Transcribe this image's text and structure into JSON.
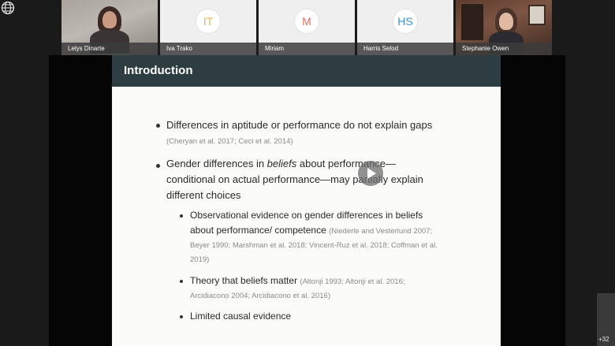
{
  "participants": [
    {
      "name": "Lelys Dinarte",
      "type": "video"
    },
    {
      "name": "Iva Trako",
      "type": "initials",
      "initials": "IT",
      "color": "#e8b64a"
    },
    {
      "name": "Miriam",
      "type": "initials",
      "initials": "M",
      "color": "#e0705e"
    },
    {
      "name": "Harris Selod",
      "type": "initials",
      "initials": "HS",
      "color": "#3d8fd1"
    },
    {
      "name": "Stephanie Owen",
      "type": "video"
    }
  ],
  "slide": {
    "title": "Introduction",
    "bullet1": {
      "text": "Differences in aptitude or performance do not explain gaps",
      "cite": "(Cheryan et al. 2017; Ceci et al. 2014)"
    },
    "bullet2": {
      "line1_pre": "Gender differences in ",
      "line1_em": "beliefs",
      "line1_post": " about performance—",
      "line2": "conditional on actual performance—may partially explain",
      "line3": "different choices"
    },
    "sub1": {
      "line1": "Observational evidence on gender differences in beliefs",
      "line2": "about performance/ competence",
      "cite1": "(Niederle and Vesterlund 2007;",
      "cite2": "Beyer 1990; Marshman et al. 2018; Vincent-Ruz et al. 2018; Coffman et al.",
      "cite3": "2019)"
    },
    "sub2": {
      "text": "Theory that beliefs matter",
      "cite1": "(Altonji 1993; Altonji et al. 2016;",
      "cite2": "Arcidiacono 2004; Arcidiacono et al. 2016)"
    },
    "sub3": {
      "text": "Limited causal evidence"
    }
  },
  "more_participants": "+32",
  "icons": {
    "top_left": "globe-icon",
    "center": "play-icon"
  }
}
